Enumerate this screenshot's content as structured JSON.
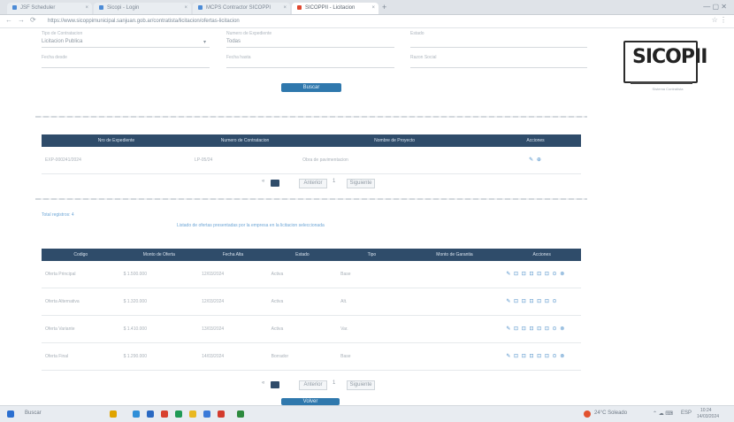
{
  "browser": {
    "tabs": [
      {
        "label": "JSF Scheduler"
      },
      {
        "label": "Sicopi - Login"
      },
      {
        "label": "MCPS Contractor SICOPPI"
      },
      {
        "label": "SICOPPII - Licitacion"
      }
    ],
    "new_tab": "+",
    "url": "https://www.sicoppimunicipal.sanjuan.gob.ar/contratista/licitacion/ofertas-licitacion",
    "back": "←",
    "forward": "→",
    "reload": "⟳"
  },
  "logo": {
    "text": "SICOPII",
    "caption": "Sistema Contratista"
  },
  "filters": {
    "row1": [
      {
        "label": "Tipo de Contratacion",
        "value": "Licitacion Publica"
      },
      {
        "label": "Numero de Expediente",
        "value": "Todas"
      },
      {
        "label": "Estado",
        "value": ""
      }
    ],
    "row2": [
      {
        "label": "Fecha desde",
        "value": ""
      },
      {
        "label": "Fecha hasta",
        "value": ""
      },
      {
        "label": "Razon Social",
        "value": ""
      }
    ],
    "search_button": "Buscar"
  },
  "table1": {
    "headers": [
      "Nro de Expediente",
      "Numero de Contratacion",
      "Nombre de Proyecto",
      "Acciones"
    ],
    "rows": [
      {
        "cells": [
          "EXP-000241/2024",
          "LP-05/24",
          "Obra de pavimentacion"
        ],
        "actions": "✎ ⊕"
      }
    ]
  },
  "pager1": {
    "first": "«",
    "prev": "Anterior",
    "next": "Siguiente",
    "sep": "1"
  },
  "mid": {
    "total_label": "Total registros: 4",
    "notice": "Listado de ofertas presentadas por la empresa en la licitacion seleccionada"
  },
  "table2": {
    "headers": [
      "Codigo",
      "Monto de Oferta",
      "Fecha Alta",
      "Estado",
      "Tipo",
      "Monto de Garantia",
      "Acciones"
    ],
    "rows": [
      {
        "cells": [
          "Oferta Principal",
          "$ 1.500.000",
          "12/03/2024",
          "Activa",
          "Base",
          ""
        ],
        "actions": "✎ ⊡ ⊡ ⊡ ⊡ ⊡ ⊙ ⊗"
      },
      {
        "cells": [
          "Oferta Alternativa",
          "$ 1.320.000",
          "12/03/2024",
          "Activa",
          "Alt.",
          ""
        ],
        "actions": "✎ ⊡ ⊡ ⊡ ⊡ ⊡ ⊙"
      },
      {
        "cells": [
          "Oferta Variante",
          "$ 1.410.000",
          "13/03/2024",
          "Activa",
          "Var.",
          ""
        ],
        "actions": "✎ ⊡ ⊡ ⊡ ⊡ ⊡ ⊙ ⊗"
      },
      {
        "cells": [
          "Oferta Final",
          "$ 1.290.000",
          "14/03/2024",
          "Borrador",
          "Base",
          ""
        ],
        "actions": "✎ ⊡ ⊡ ⊡ ⊡ ⊡ ⊙ ⊗"
      }
    ]
  },
  "pager2": {
    "first": "«",
    "prev": "Anterior",
    "next": "Siguiente",
    "sep": "1"
  },
  "bottom_button": "Volver",
  "taskbar": {
    "search": "Buscar",
    "weather": "24°C Soleado",
    "clock": "10:24",
    "date": "14/03/2024",
    "lang": "ESP"
  }
}
